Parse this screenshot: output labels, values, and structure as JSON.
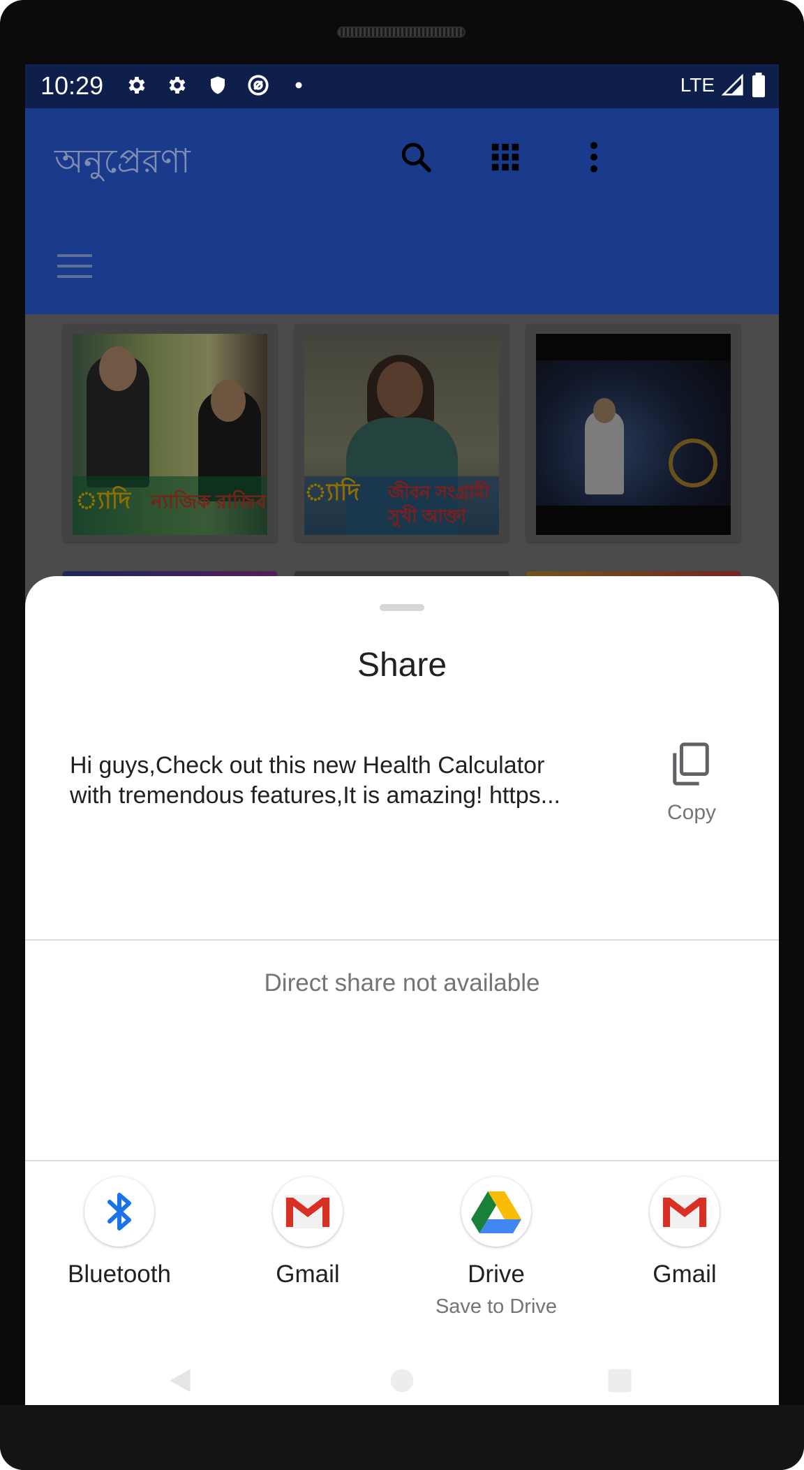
{
  "status_bar": {
    "time": "10:29",
    "network": "LTE",
    "icons": [
      "settings-icon",
      "settings-icon",
      "shield-icon",
      "at-sign-icon",
      "dot-icon",
      "signal-icon",
      "battery-icon"
    ]
  },
  "app_bar": {
    "title": "অনুপ্রেরণা",
    "actions": [
      "search-icon",
      "grid-icon",
      "more-vert-icon"
    ],
    "colors": {
      "primary": "#1a3b8c",
      "status": "#0d1f4a"
    }
  },
  "content": {
    "cards": [
      {
        "caption": "ন্যাজিক রাজিব",
        "badge": "্যাদি"
      },
      {
        "caption": "জীবন সংগ্রামী সুখী আক্তা",
        "badge": "্যাদি"
      },
      {
        "caption": "",
        "badge": ""
      }
    ]
  },
  "share_sheet": {
    "title": "Share",
    "text_line1": "Hi guys,Check out this new Health Calculator",
    "text_line2": "with tremendous features,It is amazing! https...",
    "copy_label": "Copy",
    "direct_share_message": "Direct share not available",
    "targets": [
      {
        "label": "Bluetooth",
        "sub": "",
        "icon": "bluetooth-icon"
      },
      {
        "label": "Gmail",
        "sub": "",
        "icon": "gmail-icon"
      },
      {
        "label": "Drive",
        "sub": "Save to Drive",
        "icon": "drive-icon"
      },
      {
        "label": "Gmail",
        "sub": "",
        "icon": "gmail-icon"
      }
    ]
  }
}
